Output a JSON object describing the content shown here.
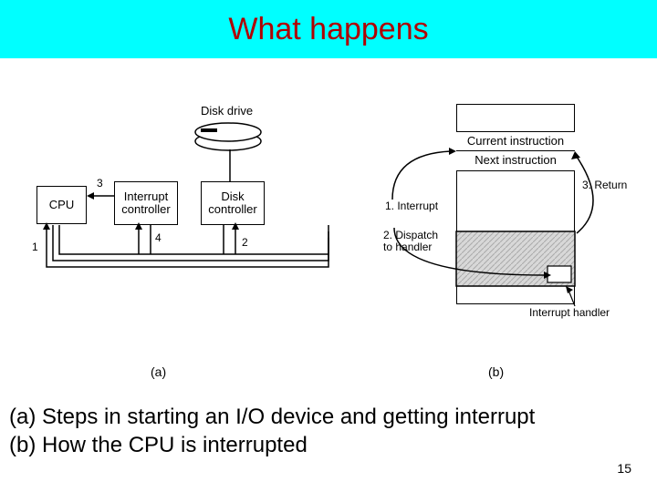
{
  "title": "What happens",
  "figA": {
    "label": "(a)",
    "diskDrive": "Disk drive",
    "cpu": "CPU",
    "intCtrl1": "Interrupt",
    "intCtrl2": "controller",
    "diskCtrl1": "Disk",
    "diskCtrl2": "controller",
    "n1": "1",
    "n2": "2",
    "n3": "3",
    "n4": "4"
  },
  "figB": {
    "label": "(b)",
    "curInstr": "Current instruction",
    "nextInstr": "Next instruction",
    "interrupt": "1. Interrupt",
    "dispatch1": "2. Dispatch",
    "dispatch2": "to handler",
    "ret": "3. Return",
    "handler": "Interrupt handler"
  },
  "caption": {
    "lineA": "(a) Steps in starting an I/O device and getting interrupt",
    "lineB": "(b) How the CPU is interrupted"
  },
  "pageNumber": "15"
}
